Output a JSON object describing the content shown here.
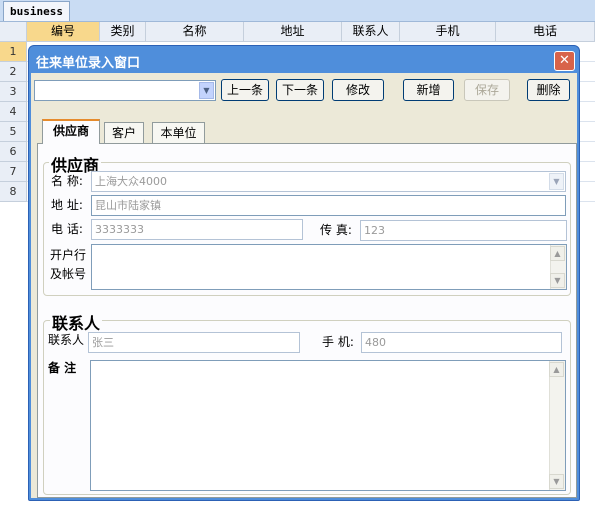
{
  "sheet": {
    "tab_name": "business",
    "columns": [
      "编号",
      "类别",
      "名称",
      "地址",
      "联系人",
      "手机",
      "电话"
    ],
    "rows": [
      "1",
      "2",
      "3",
      "4",
      "5",
      "6",
      "7",
      "8"
    ]
  },
  "dialog": {
    "title": "往来单位录入窗口",
    "close_glyph": "✕",
    "record_selector": "",
    "buttons": {
      "prev": "上一条",
      "next": "下一条",
      "edit": "修改",
      "add": "新增",
      "save": "保存",
      "delete": "删除"
    },
    "tabs": [
      "供应商",
      "客户",
      "本单位"
    ],
    "supplier_group": {
      "title": "供应商",
      "name_label": "名 称:",
      "name_value": "上海大众4000",
      "address_label": "地 址:",
      "address_value": "昆山市陆家镇",
      "phone_label": "电 话:",
      "phone_value": "3333333",
      "fax_label": "传 真:",
      "fax_value": "123",
      "bank_label_line1": "开户行",
      "bank_label_line2": "及帐号",
      "bank_value": ""
    },
    "contact_group": {
      "title": "联系人",
      "contact_label": "联系人",
      "contact_value": "张三",
      "mobile_label": "手 机:",
      "mobile_value": "480",
      "notes_label": "备 注",
      "notes_value": ""
    }
  }
}
